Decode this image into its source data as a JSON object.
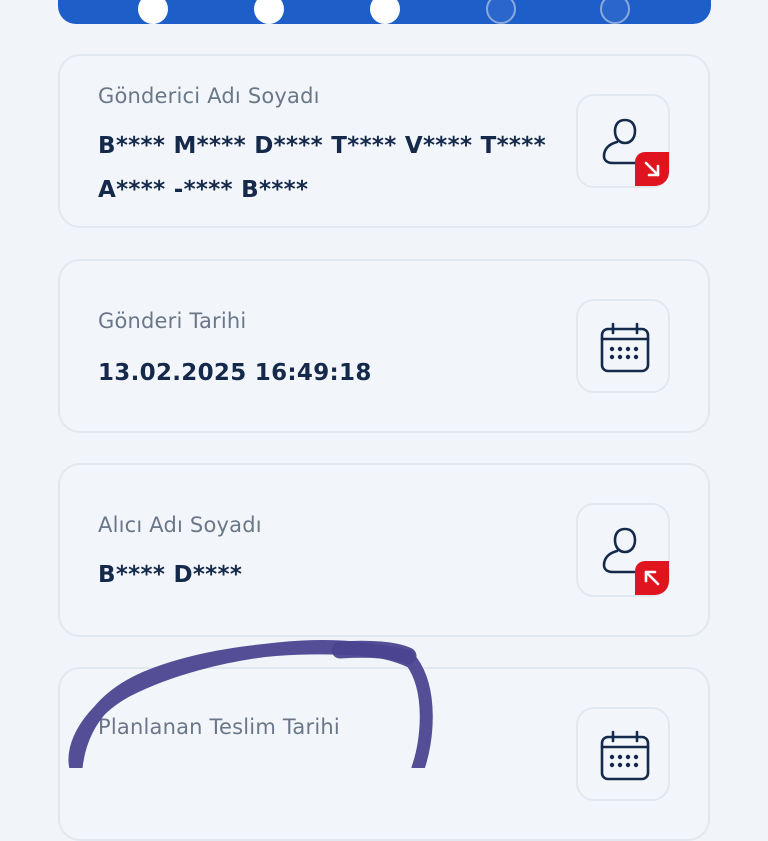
{
  "stepper": {
    "steps": [
      "done",
      "done",
      "done",
      "pending",
      "pending"
    ]
  },
  "cards": {
    "sender": {
      "label": "Gönderici Adı Soyadı",
      "value": "B**** M**** D**** T**** V**** T**** A**** -**** B****",
      "icon": "user-outgoing-icon"
    },
    "send_date": {
      "label": "Gönderi Tarihi",
      "value": "13.02.2025 16:49:18",
      "icon": "calendar-icon"
    },
    "receiver": {
      "label": "Alıcı Adı Soyadı",
      "value": "B**** D****",
      "icon": "user-incoming-icon"
    },
    "planned_delivery": {
      "label": "Planlanan Teslim Tarihi",
      "value": "",
      "icon": "calendar-icon"
    }
  },
  "colors": {
    "primary": "#1e5ec8",
    "accent": "#e0141e",
    "text_dark": "#15294a",
    "text_muted": "#6a7788",
    "scribble": "#4b4590"
  }
}
